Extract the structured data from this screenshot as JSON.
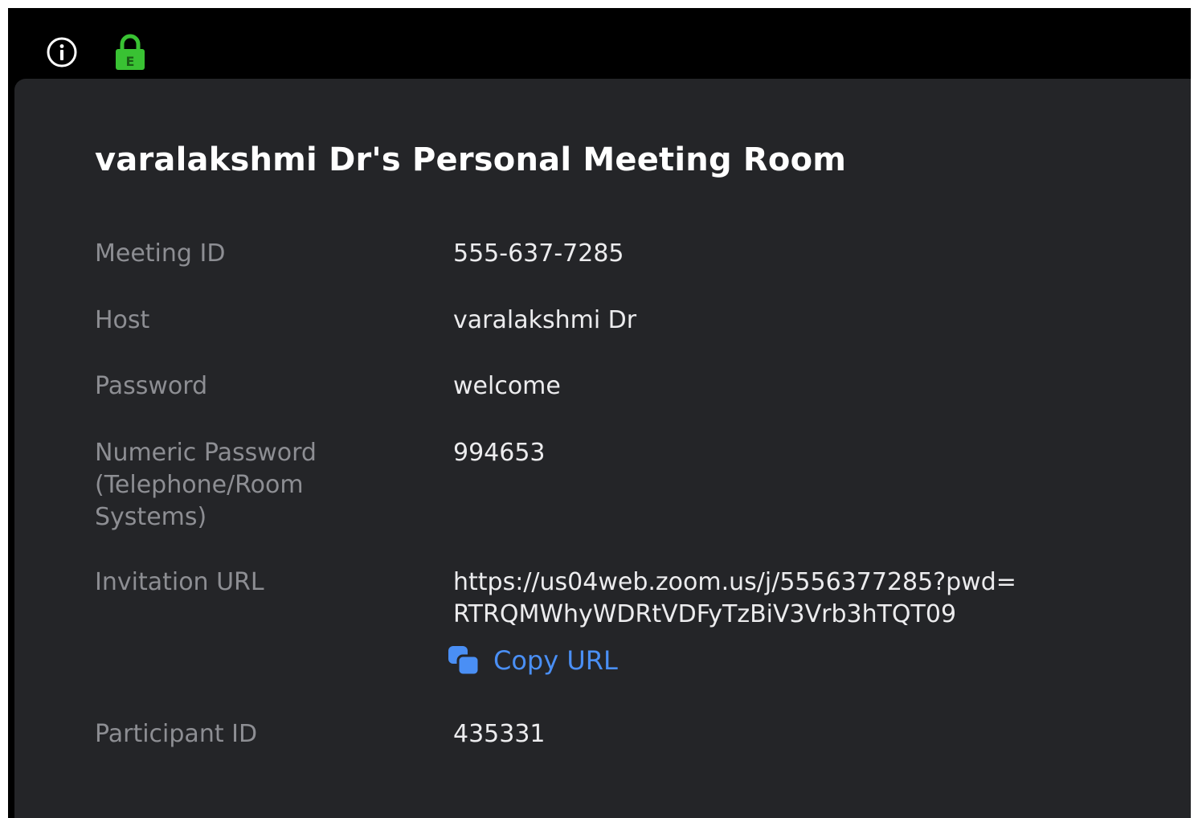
{
  "header": {
    "info_icon": "info-circle-icon",
    "lock_icon": "encryption-lock-icon",
    "lock_badge": "E",
    "lock_color": "#39c233"
  },
  "meeting": {
    "title": "varalakshmi Dr's Personal Meeting Room",
    "fields": [
      {
        "label": "Meeting ID",
        "value": "555-637-7285"
      },
      {
        "label": "Host",
        "value": "varalakshmi Dr"
      },
      {
        "label": "Password",
        "value": "welcome"
      },
      {
        "label": "Numeric Password (Telephone/Room Systems)",
        "value": "994653"
      },
      {
        "label": "Invitation URL",
        "value_line1": "https://us04web.zoom.us/j/5556377285?pwd=",
        "value_line2": "RTRQMWhyWDRtVDFyTzBiV3Vrb3hTQT09"
      },
      {
        "label": "Participant ID",
        "value": "435331"
      }
    ],
    "copy_url_label": "Copy URL",
    "copy_icon": "copy-icon",
    "accent_color": "#4a8ff5"
  }
}
